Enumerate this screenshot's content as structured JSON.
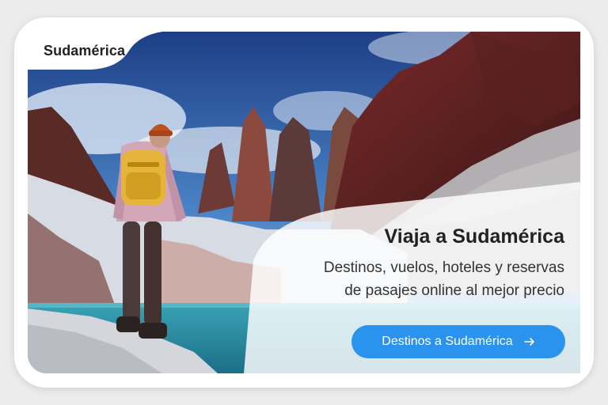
{
  "tag": {
    "label": "Sudamérica"
  },
  "hero": {
    "headline": "Viaja a Sudamérica",
    "subline_1": "Destinos, vuelos, hoteles y reservas",
    "subline_2": "de pasajes online al mejor precio"
  },
  "cta": {
    "label": "Destinos a Sudamérica",
    "icon": "arrow-right-icon"
  },
  "colors": {
    "accent": "#2a93ee",
    "text_dark": "#222222",
    "sky": "#2d5ea8",
    "lake": "#3fa9b8"
  }
}
